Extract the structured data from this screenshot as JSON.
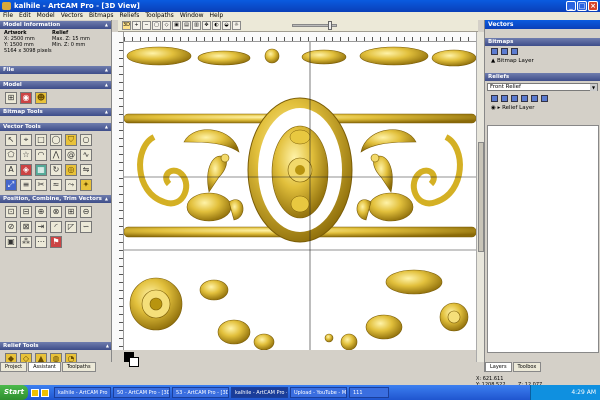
{
  "window": {
    "title": "kalhile - ArtCAM Pro - [3D View]"
  },
  "menu": [
    "File",
    "Edit",
    "Model",
    "Vectors",
    "Bitmaps",
    "Reliefs",
    "Toolpaths",
    "Window",
    "Help"
  ],
  "toolbar": {
    "view_3d": "3D",
    "slider_level": 0.85
  },
  "left_panel": {
    "model_information": {
      "header": "Model Information",
      "artwork_label": "Artwork",
      "relief_label": "Relief",
      "x": "X: 2500 mm",
      "y": "Y: 1500 mm",
      "max_z": "Max. Z: 15 mm",
      "min_z": "Min. Z: 0 mm",
      "pixels": "5164 x 3098 pixels"
    },
    "sections": {
      "file": "File",
      "model": "Model",
      "bitmap_tools": "Bitmap Tools",
      "vector_tools": "Vector Tools",
      "position_tools": "Position, Combine, Trim Vectors",
      "relief_tools": "Relief Tools"
    },
    "tabs": [
      "Project",
      "Assistant",
      "Toolpaths"
    ]
  },
  "right_panel": {
    "title": "Vectors",
    "bitmaps_header": "Bitmaps",
    "bitmap_layer": "Bitmap Layer",
    "reliefs_header": "Reliefs",
    "relief_select": "Front Relief",
    "relief_layer": "Relief Layer",
    "tabs": [
      "Layers",
      "Toolbox"
    ]
  },
  "status": {
    "x": "X: 621.611",
    "y": "Y: 1208.522",
    "z": "Z: 12.077"
  },
  "taskbar": {
    "start": "Start",
    "tasks": [
      "kalhile - ArtCAM Pro",
      "50 - ArtCAM Pro - [3D View]",
      "53 - ArtCAM Pro - [3D View]",
      "kalhile - ArtCAM Pro - [3D View]",
      "Upload - YouTube - Mozilla",
      "111"
    ],
    "clock": "4:29 AM"
  },
  "colors": {
    "relief_gold": "#d4b024",
    "title_blue": "#0a4fd0"
  }
}
